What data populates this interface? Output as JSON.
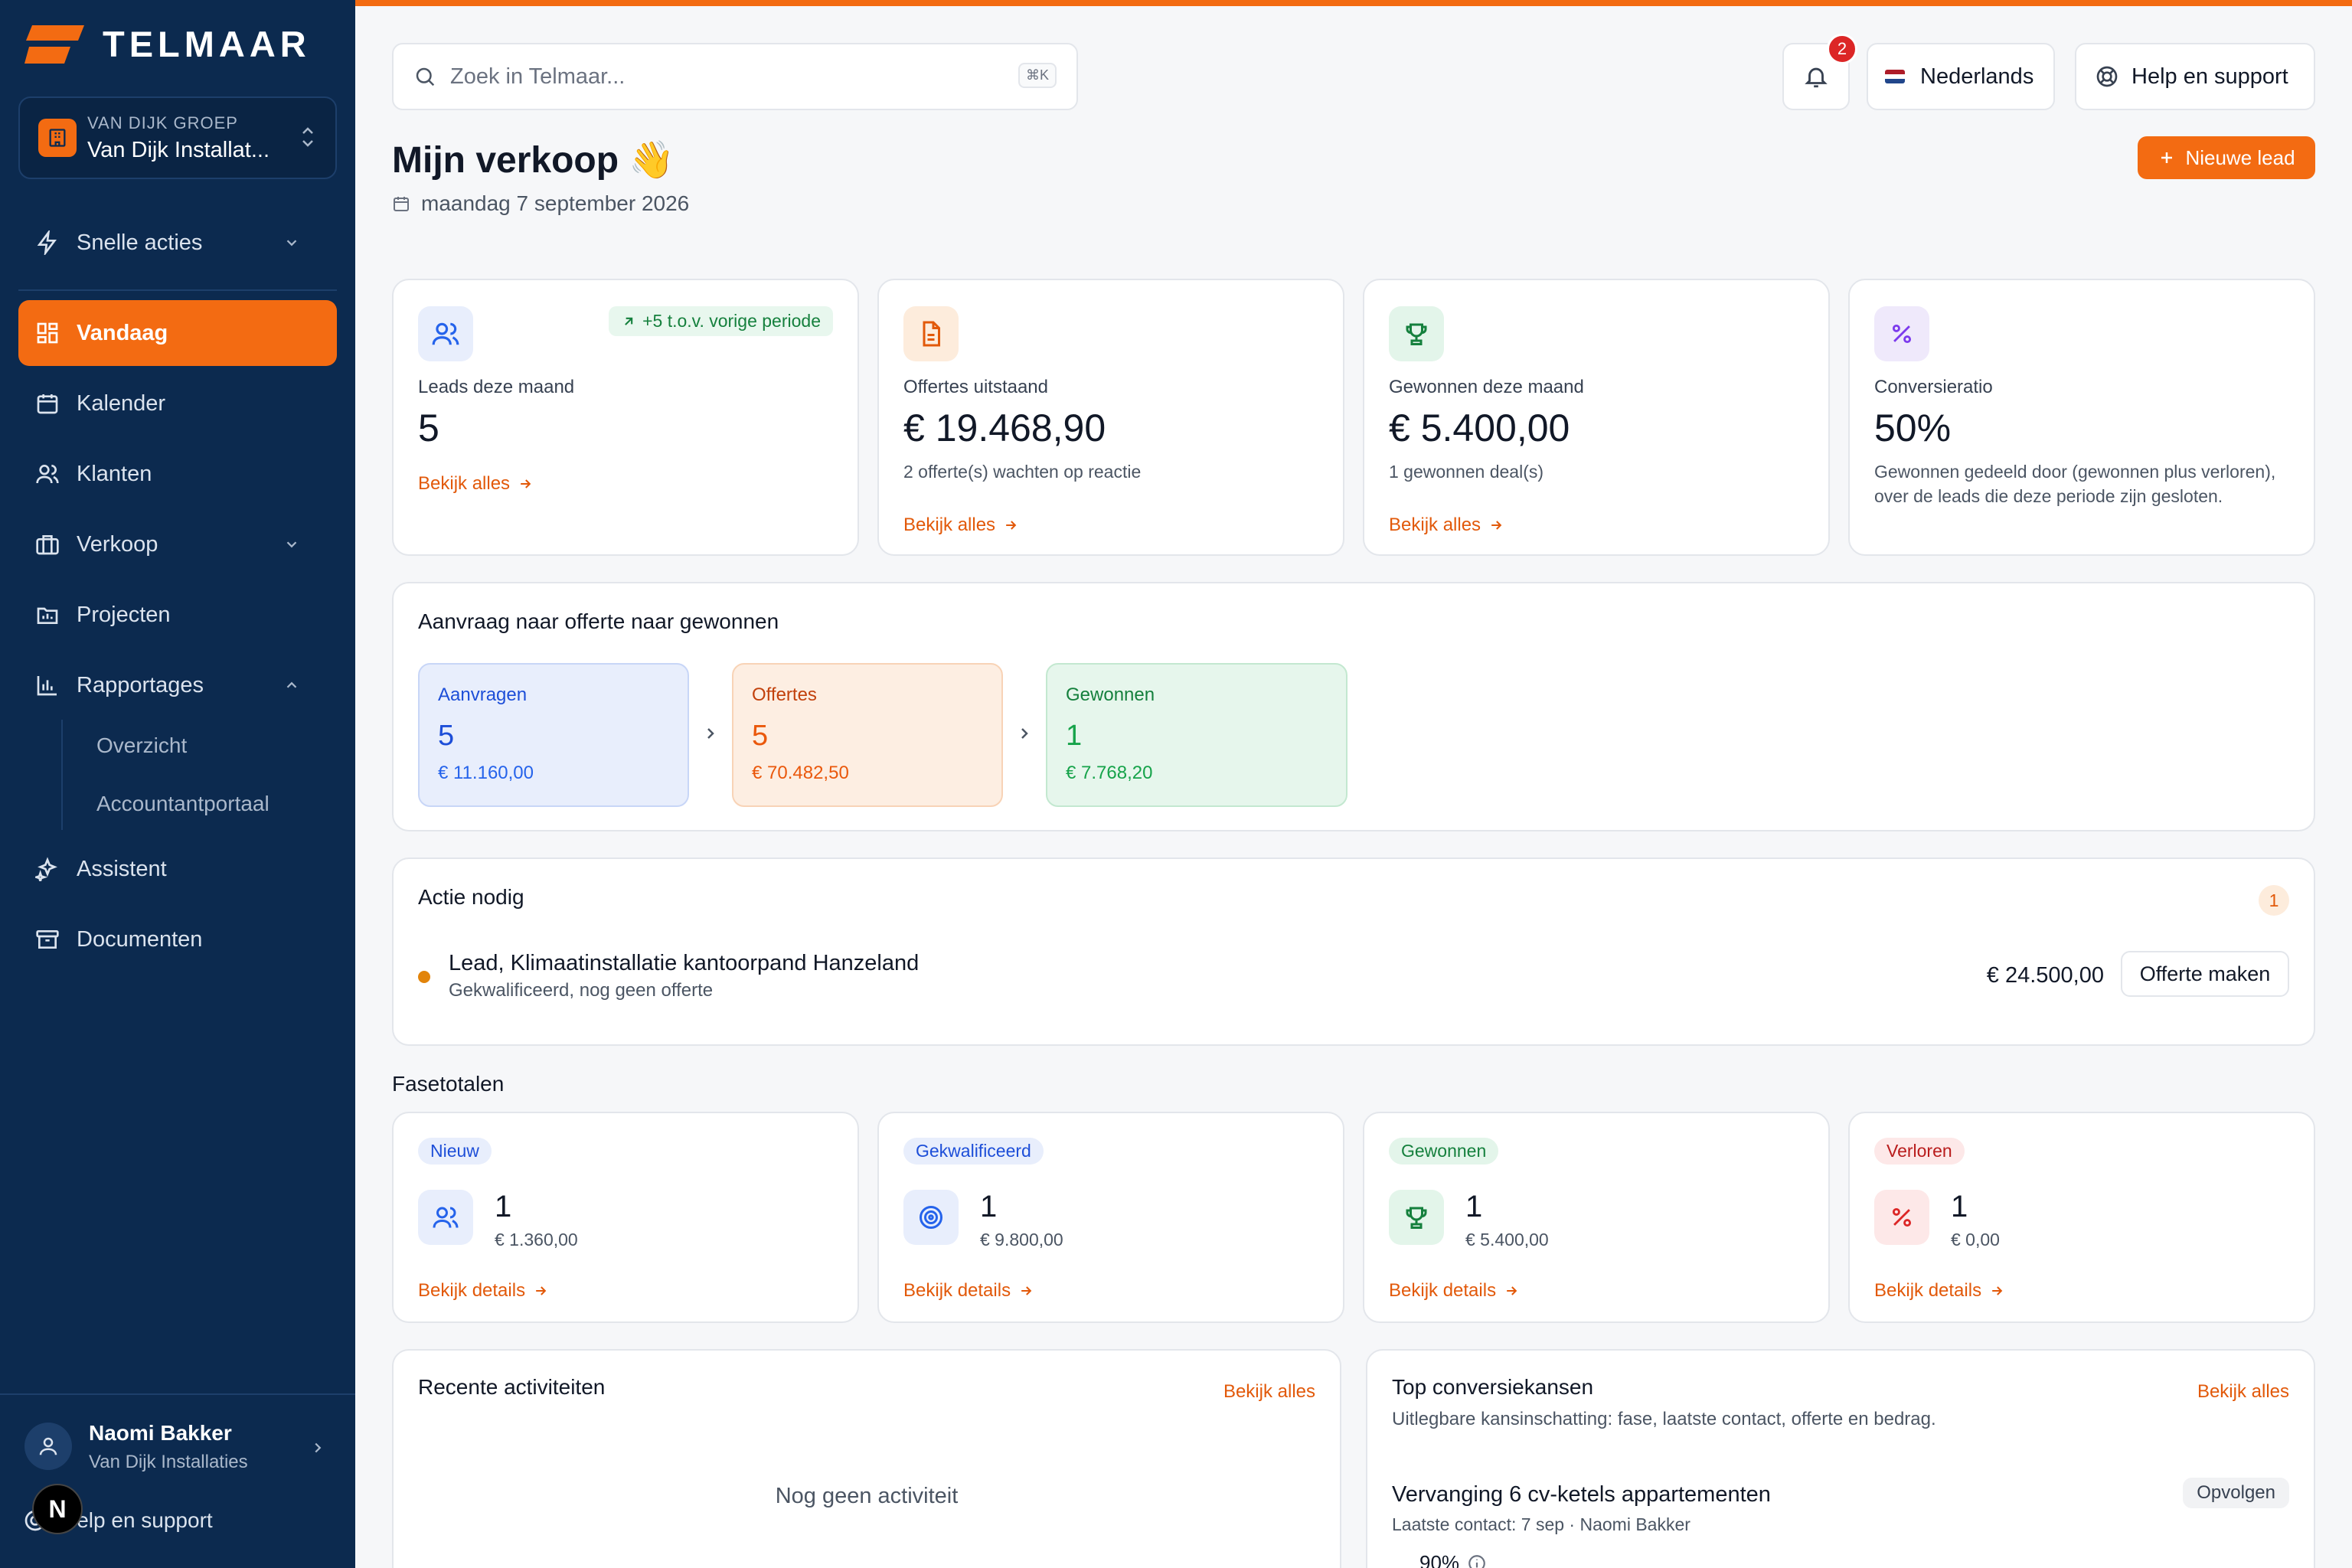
{
  "brand": {
    "name": "TELMAAR",
    "accent": "#f36b12",
    "sidebar_bg": "#0c2a4f"
  },
  "org": {
    "group": "VAN DIJK GROEP",
    "name": "Van Dijk Installat..."
  },
  "sidebar": {
    "quick_actions": "Snelle acties",
    "items": [
      "Vandaag",
      "Kalender",
      "Klanten",
      "Verkoop",
      "Projecten",
      "Rapportages",
      "Assistent",
      "Documenten"
    ],
    "reports_sub": [
      "Overzicht",
      "Accountantportaal"
    ]
  },
  "user": {
    "name": "Naomi Bakker",
    "company": "Van Dijk Installaties",
    "help": "Help en support",
    "badge": "N"
  },
  "topbar": {
    "search_placeholder": "Zoek in Telmaar...",
    "search_shortcut": "⌘K",
    "notifications": "2",
    "language": "Nederlands",
    "help": "Help en support"
  },
  "page": {
    "title": "Mijn verkoop 👋",
    "date": "maandag 7 september 2026",
    "new_lead": "Nieuwe lead"
  },
  "kpis": [
    {
      "title": "Leads deze maand",
      "value": "5",
      "sub": "",
      "trend": "+5 t.o.v. vorige periode",
      "link": "Bekijk alles"
    },
    {
      "title": "Offertes uitstaand",
      "value": "€ 19.468,90",
      "sub": "2 offerte(s) wachten op reactie",
      "link": "Bekijk alles"
    },
    {
      "title": "Gewonnen deze maand",
      "value": "€ 5.400,00",
      "sub": "1 gewonnen deal(s)",
      "link": "Bekijk alles"
    },
    {
      "title": "Conversieratio",
      "value": "50%",
      "sub": "Gewonnen gedeeld door (gewonnen plus verloren), over de leads die deze periode zijn gesloten."
    }
  ],
  "funnel": {
    "title": "Aanvraag naar offerte naar gewonnen",
    "steps": [
      {
        "label": "Aanvragen",
        "value": "5",
        "amount": "€ 11.160,00"
      },
      {
        "label": "Offertes",
        "value": "5",
        "amount": "€ 70.482,50"
      },
      {
        "label": "Gewonnen",
        "value": "1",
        "amount": "€ 7.768,20"
      }
    ]
  },
  "actions": {
    "title": "Actie nodig",
    "count": "1",
    "item": {
      "title": "Lead, Klimaatinstallatie kantoorpand Hanzeland",
      "sub": "Gekwalificeerd, nog geen offerte",
      "amount": "€ 24.500,00",
      "button": "Offerte maken"
    }
  },
  "phases": {
    "title": "Fasetotalen",
    "items": [
      {
        "label": "Nieuw",
        "count": "1",
        "amount": "€ 1.360,00",
        "link": "Bekijk details"
      },
      {
        "label": "Gekwalificeerd",
        "count": "1",
        "amount": "€ 9.800,00",
        "link": "Bekijk details"
      },
      {
        "label": "Gewonnen",
        "count": "1",
        "amount": "€ 5.400,00",
        "link": "Bekijk details"
      },
      {
        "label": "Verloren",
        "count": "1",
        "amount": "€ 0,00",
        "link": "Bekijk details"
      }
    ]
  },
  "recent": {
    "title": "Recente activiteiten",
    "link": "Bekijk alles",
    "empty": "Nog geen activiteit"
  },
  "top": {
    "title": "Top conversiekansen",
    "link": "Bekijk alles",
    "sub": "Uitlegbare kansinschatting: fase, laatste contact, offerte en bedrag.",
    "item": {
      "title": "Vervanging 6 cv-ketels appartementen",
      "sub": "Laatste contact: 7 sep · Naomi Bakker",
      "badge": "Opvolgen",
      "pct": "90%"
    }
  }
}
